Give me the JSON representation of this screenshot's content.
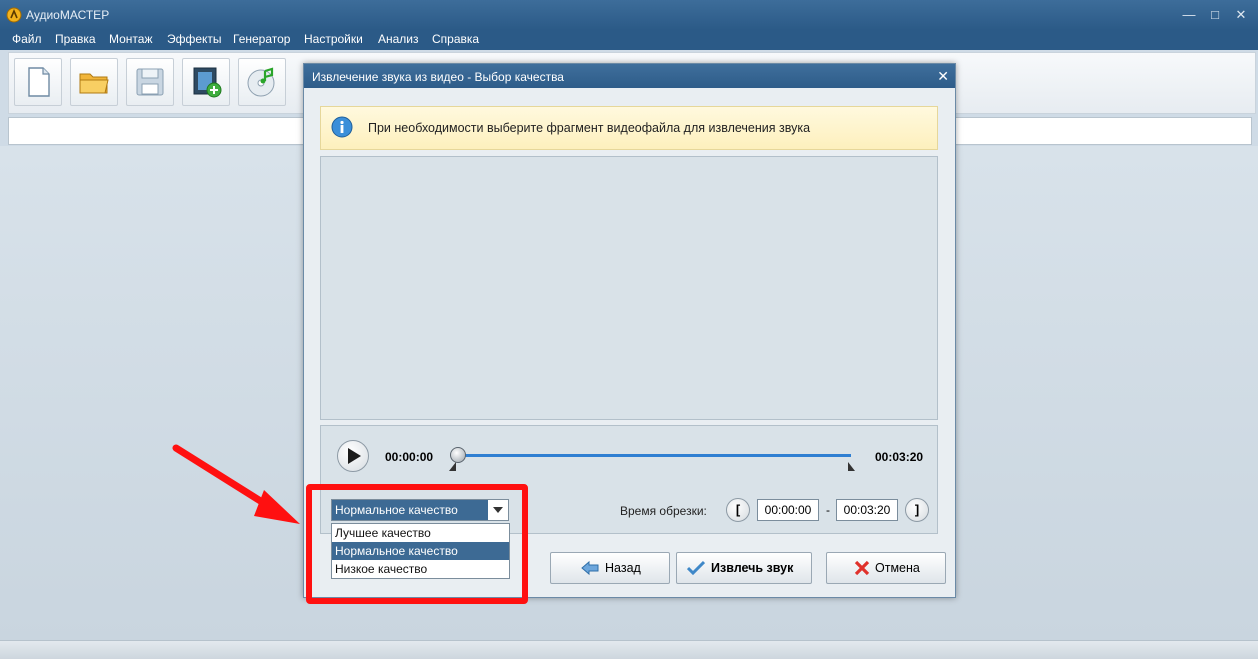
{
  "window": {
    "title": "АудиоМАСТЕР",
    "controls": [
      "—",
      "□",
      "✕"
    ]
  },
  "menu": [
    "Файл",
    "Правка",
    "Монтаж",
    "Эффекты",
    "Генератор",
    "Настройки",
    "Анализ",
    "Справка"
  ],
  "toolbar": {
    "icons": [
      "new-file-icon",
      "open-folder-icon",
      "save-disk-icon",
      "add-video-icon",
      "cd-music-icon"
    ]
  },
  "dialog": {
    "title": "Извлечение звука из видео - Выбор качества",
    "close": "✕",
    "info_text": "При необходимости выберите фрагмент видеофайла для извлечения звука",
    "time_start": "00:00:00",
    "time_end": "00:03:20",
    "quality": {
      "selected": "Нормальное качество",
      "options": [
        "Лучшее качество",
        "Нормальное качество",
        "Низкое качество"
      ]
    },
    "trim": {
      "label": "Время обрезки:",
      "from": "00:00:00",
      "sep": "-",
      "to": "00:03:20",
      "open_bracket": "[",
      "close_bracket": "]"
    },
    "buttons": {
      "back": "Назад",
      "extract": "Извлечь звук",
      "cancel": "Отмена"
    }
  },
  "colors": {
    "accent": "#2f7fd2",
    "highlight": "#ff1010",
    "title_bar": "#2e5c89"
  }
}
